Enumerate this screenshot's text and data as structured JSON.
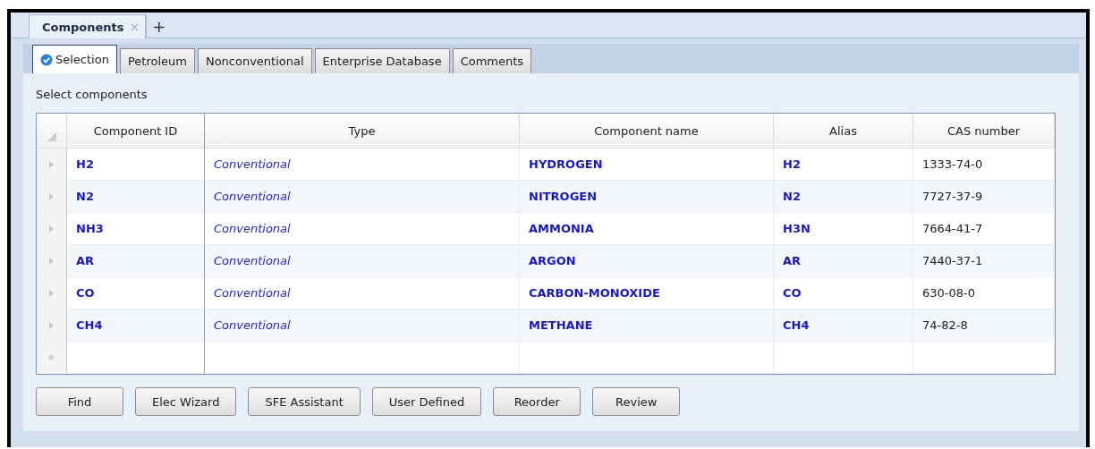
{
  "document_tabs": [
    {
      "label": "Components",
      "close": "×",
      "selected": true
    }
  ],
  "new_tab": "+",
  "tabs": [
    {
      "label": "Selection",
      "selected": true
    },
    {
      "label": "Petroleum",
      "selected": false
    },
    {
      "label": "Nonconventional",
      "selected": false
    },
    {
      "label": "Enterprise Database",
      "selected": false
    },
    {
      "label": "Comments",
      "selected": false
    }
  ],
  "section_label": "Select components",
  "table": {
    "columns": [
      "Component ID",
      "Type",
      "Component name",
      "Alias",
      "CAS number"
    ],
    "rows": [
      [
        "H2",
        "Conventional",
        "HYDROGEN",
        "H2",
        "1333-74-0"
      ],
      [
        "N2",
        "Conventional",
        "NITROGEN",
        "N2",
        "7727-37-9"
      ],
      [
        "NH3",
        "Conventional",
        "AMMONIA",
        "H3N",
        "7664-41-7"
      ],
      [
        "AR",
        "Conventional",
        "ARGON",
        "AR",
        "7440-37-1"
      ],
      [
        "CO",
        "Conventional",
        "CARBON-MONOXIDE",
        "CO",
        "630-08-0"
      ],
      [
        "CH4",
        "Conventional",
        "METHANE",
        "CH4",
        "74-82-8"
      ]
    ]
  },
  "buttons": [
    "Find",
    "Elec Wizard",
    "SFE Assistant",
    "User Defined",
    "Reorder",
    "Review"
  ]
}
